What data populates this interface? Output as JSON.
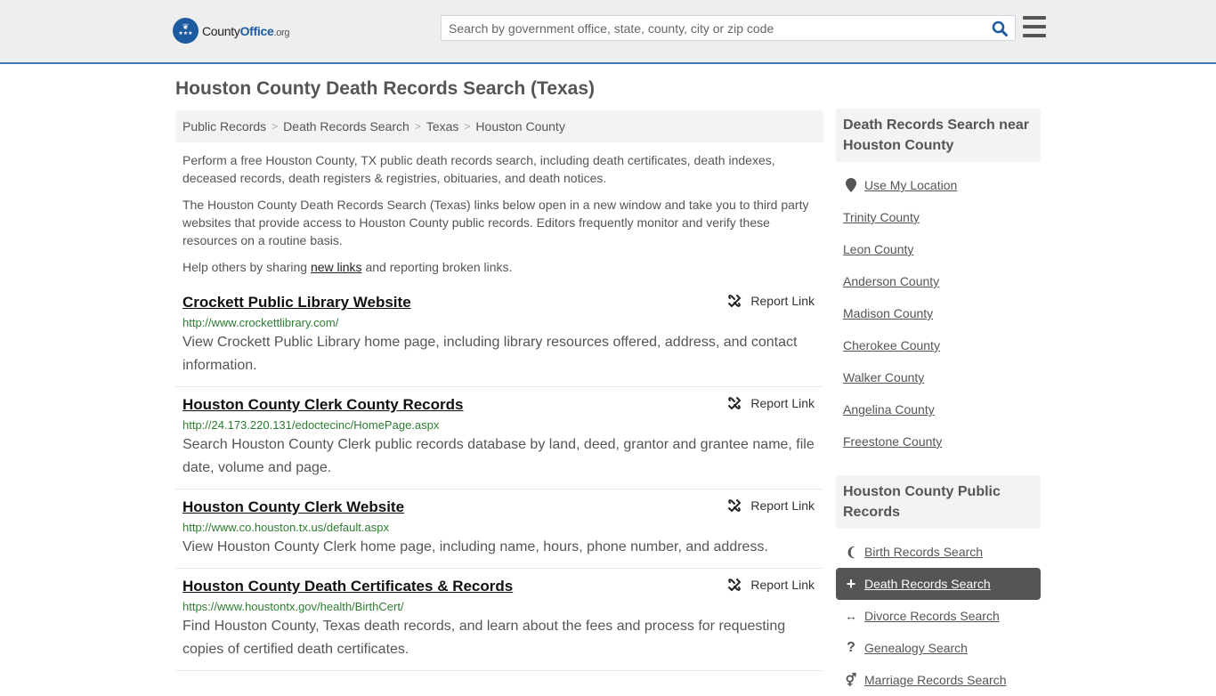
{
  "header": {
    "logo": {
      "part1": "County",
      "part2": "Office",
      "part3": ".org"
    },
    "search": {
      "placeholder": "Search by government office, state, county, city or zip code",
      "value": ""
    },
    "colors": {
      "accent": "#1d5ba0",
      "border": "#3d7ab5",
      "header_bg": "#eeeeee"
    }
  },
  "page": {
    "title": "Houston County Death Records Search (Texas)"
  },
  "breadcrumb": [
    {
      "label": "Public Records"
    },
    {
      "label": "Death Records Search"
    },
    {
      "label": "Texas"
    },
    {
      "label": "Houston County"
    }
  ],
  "intro": {
    "p1": "Perform a free Houston County, TX public death records search, including death certificates, death indexes, deceased records, death registers & registries, obituaries, and death notices.",
    "p2": "The Houston County Death Records Search (Texas) links below open in a new window and take you to third party websites that provide access to Houston County public records. Editors frequently monitor and verify these resources on a routine basis.",
    "p3_before": "Help others by sharing ",
    "p3_link": "new links",
    "p3_after": " and reporting broken links."
  },
  "listings": [
    {
      "title": "Crockett Public Library Website",
      "url": "http://www.crockettlibrary.com/",
      "description": "View Crockett Public Library home page, including library resources offered, address, and contact information.",
      "report_label": "Report Link"
    },
    {
      "title": "Houston County Clerk County Records",
      "url": "http://24.173.220.131/edoctecinc/HomePage.aspx",
      "description": "Search Houston County Clerk public records database by land, deed, grantor and grantee name, file date, volume and page.",
      "report_label": "Report Link"
    },
    {
      "title": "Houston County Clerk Website",
      "url": "http://www.co.houston.tx.us/default.aspx",
      "description": "View Houston County Clerk home page, including name, hours, phone number, and address.",
      "report_label": "Report Link"
    },
    {
      "title": "Houston County Death Certificates & Records",
      "url": "https://www.houstontx.gov/health/BirthCert/",
      "description": "Find Houston County, Texas death records, and learn about the fees and process for requesting copies of certified death certificates.",
      "report_label": "Report Link"
    }
  ],
  "sidebar": {
    "nearby": {
      "heading": "Death Records Search near Houston County",
      "use_location": "Use My Location",
      "counties": [
        "Trinity County",
        "Leon County",
        "Anderson County",
        "Madison County",
        "Cherokee County",
        "Walker County",
        "Angelina County",
        "Freestone County"
      ]
    },
    "public_records": {
      "heading": "Houston County Public Records",
      "items": [
        {
          "label": "Birth Records Search",
          "icon": "child-icon",
          "active": false
        },
        {
          "label": "Death Records Search",
          "icon": "plus-icon",
          "active": true
        },
        {
          "label": "Divorce Records Search",
          "icon": "arrows-horizontal-icon",
          "active": false
        },
        {
          "label": "Genealogy Search",
          "icon": "question-icon",
          "active": false
        },
        {
          "label": "Marriage Records Search",
          "icon": "venus-mars-icon",
          "active": false
        }
      ]
    }
  }
}
